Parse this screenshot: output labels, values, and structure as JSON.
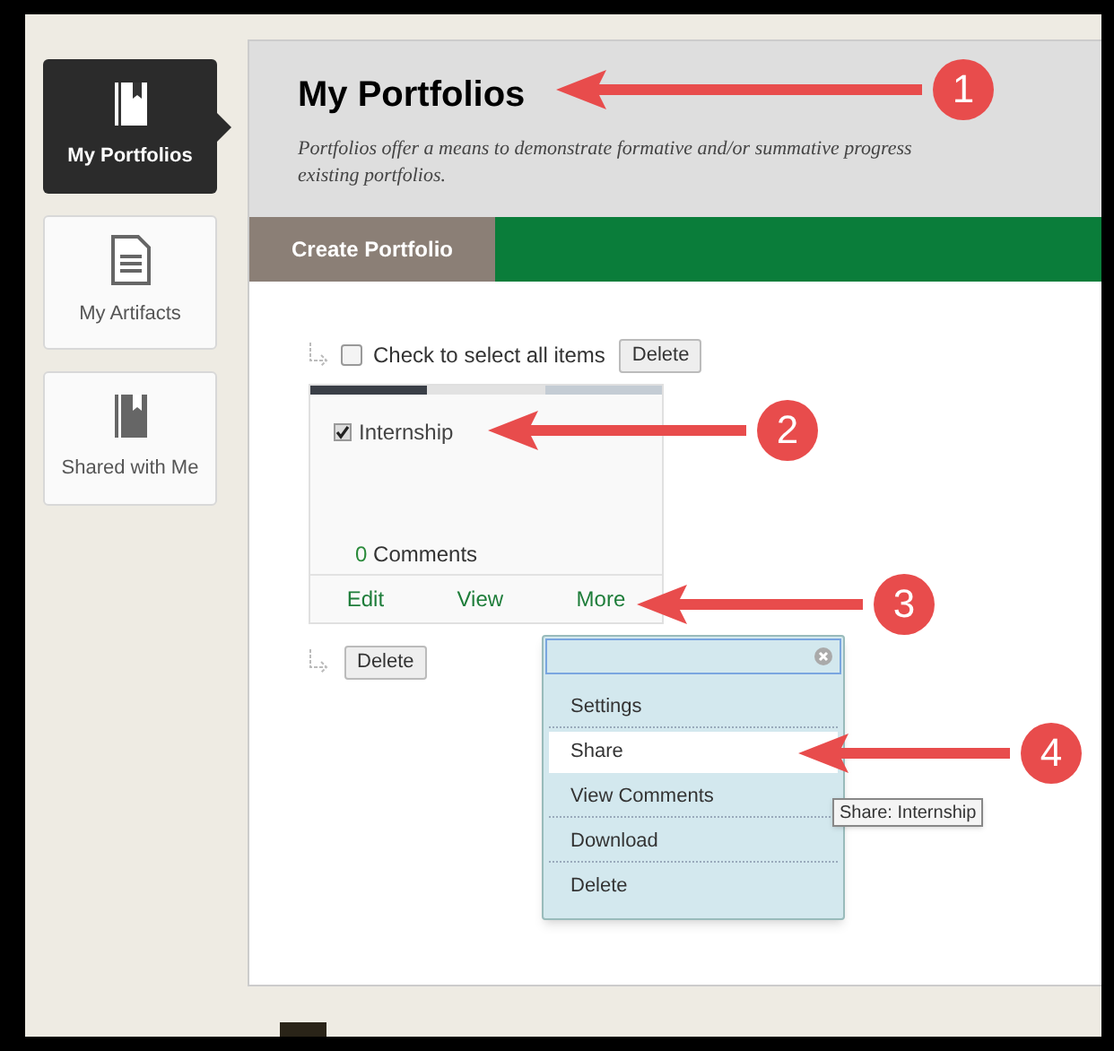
{
  "sidebar": {
    "items": [
      {
        "label": "My Portfolios",
        "kind": "book",
        "selected": true
      },
      {
        "label": "My Artifacts",
        "kind": "document",
        "selected": false
      },
      {
        "label": "Shared with Me",
        "kind": "book",
        "selected": false
      }
    ]
  },
  "header": {
    "title": "My Portfolios",
    "description_lines": [
      "Portfolios offer a means to demonstrate formative and/or summative progress",
      "existing portfolios."
    ]
  },
  "action_bar": {
    "button": "Create Portfolio"
  },
  "select_all": {
    "label": "Check to select all items",
    "checked": false,
    "button": "Delete"
  },
  "portfolio_card": {
    "title": "Internship",
    "checked": true,
    "comment_count": "0",
    "comments_label": "Comments",
    "links": [
      "Edit",
      "View",
      "More"
    ]
  },
  "bottom_button": "Delete",
  "menu": {
    "items": [
      {
        "label": "Settings",
        "selected": false,
        "divider_after": true
      },
      {
        "label": "Share",
        "selected": true,
        "divider_after": false
      },
      {
        "label": "View Comments",
        "selected": false,
        "divider_after": true
      },
      {
        "label": "Download",
        "selected": false,
        "divider_after": true
      },
      {
        "label": "Delete",
        "selected": false,
        "divider_after": false
      }
    ]
  },
  "tooltip": "Share: Internship",
  "callouts": [
    "1",
    "2",
    "3",
    "4"
  ]
}
